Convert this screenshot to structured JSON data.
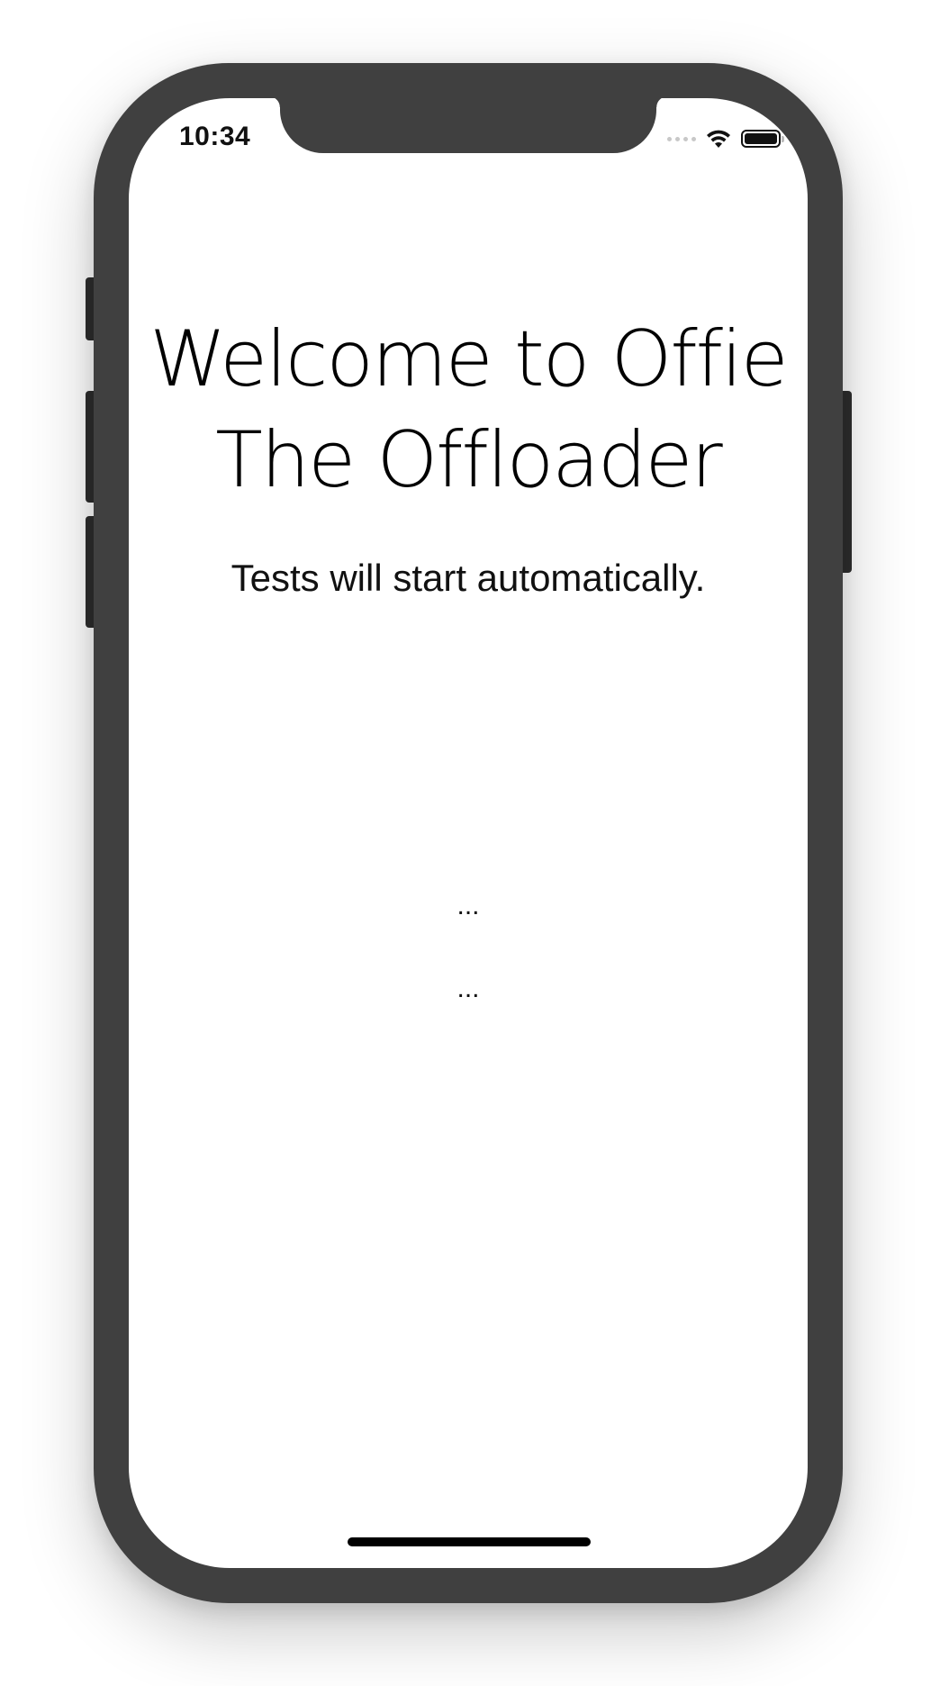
{
  "status_bar": {
    "time": "10:34",
    "signal_icon": "cellular-signal-dots",
    "wifi_icon": "wifi-icon",
    "battery_icon": "battery-full-icon",
    "battery_level": 1.0
  },
  "main": {
    "title_line1": "Welcome to Offie",
    "title_line2": "The Offloader",
    "subtitle": "Tests will start automatically.",
    "status_line1": "...",
    "status_line2": "..."
  },
  "colors": {
    "device_frame": "#404040",
    "screen_background": "#ffffff",
    "text": "#000000"
  }
}
